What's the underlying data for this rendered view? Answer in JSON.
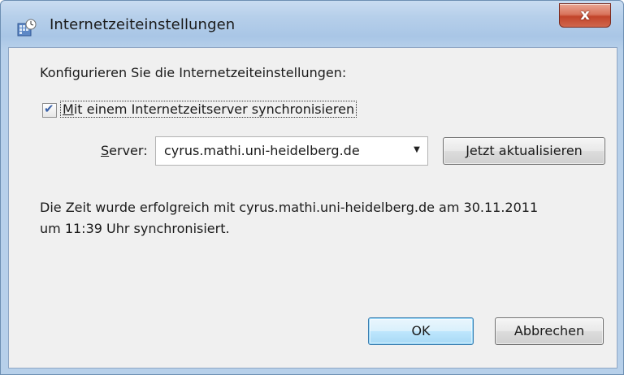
{
  "window": {
    "title": "Internetzeiteinstellungen",
    "close_glyph": "x"
  },
  "dialog": {
    "intro": "Konfigurieren Sie die Internetzeiteinstellungen:",
    "sync_checkbox": {
      "checked": true,
      "label_mnemonic": "M",
      "label_rest": "it einem Internetzeitserver synchronisieren"
    },
    "server": {
      "label_mnemonic": "S",
      "label_rest": "erver:",
      "selected": "cyrus.mathi.uni-heidelberg.de"
    },
    "update_button": {
      "mnemonic": "J",
      "rest": "etzt aktualisieren"
    },
    "status": {
      "line1": "Die Zeit wurde erfolgreich mit cyrus.mathi.uni-heidelberg.de am 30.11.2011",
      "line2": "um 11:39 Uhr synchronisiert."
    },
    "ok_label": "OK",
    "cancel_label": "Abbrechen"
  },
  "colors": {
    "titlebar": "#b6cfea",
    "close_button": "#c2442a",
    "ok_button_border": "#3c7fb1"
  },
  "icons": [
    "clock-globe-icon",
    "close-icon",
    "checkmark-icon",
    "dropdown-arrow-icon"
  ]
}
